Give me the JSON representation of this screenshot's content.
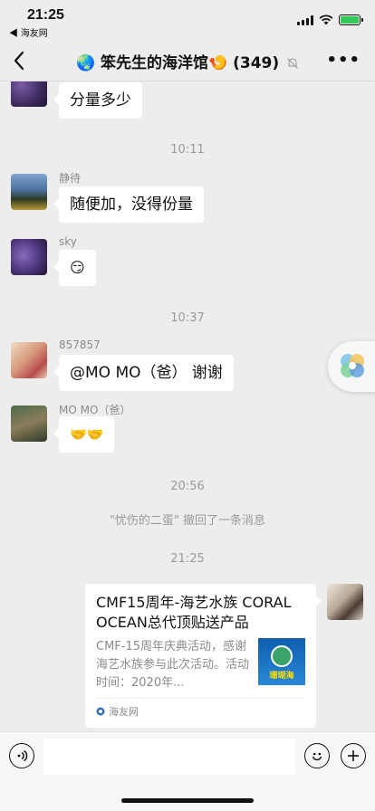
{
  "status": {
    "time": "21:25",
    "back_app": "◀ 海友网"
  },
  "nav": {
    "back_icon": "chevron-left-icon",
    "title": "🌏 笨先生的海洋馆🍤 (349)",
    "muted_icon": "bell-slash-icon",
    "more_icon": "ellipsis-icon",
    "more": "•••"
  },
  "messages": [
    {
      "text": "分量多少"
    },
    {
      "sender": "静待",
      "text": "随便加，没得份量"
    },
    {
      "sender": "sky",
      "text": "😏"
    },
    {
      "sender": "857857",
      "text": "@MO MO（爸） 谢谢"
    },
    {
      "sender": "MO MO（爸）",
      "text": "🤝🤝"
    }
  ],
  "timestamps": [
    "10:11",
    "10:37",
    "20:56",
    "21:25"
  ],
  "system_message": "\"忧伤的二蛋\" 撤回了一条消息",
  "card": {
    "title": "CMF15周年-海艺水族 CORAL OCEAN总代顶贴送产品",
    "desc": "CMF-15周年庆典活动，感谢海艺水族参与此次活动。活动时间：2020年...",
    "thumb_label": "珊瑚海",
    "source": "海友网"
  },
  "input": {
    "voice_icon": "voice-icon",
    "emoji_icon": "emoji-icon",
    "plus_icon": "plus-icon"
  },
  "colors": {
    "bg": "#ededed",
    "bubble": "#ffffff",
    "battery": "#34c759"
  }
}
